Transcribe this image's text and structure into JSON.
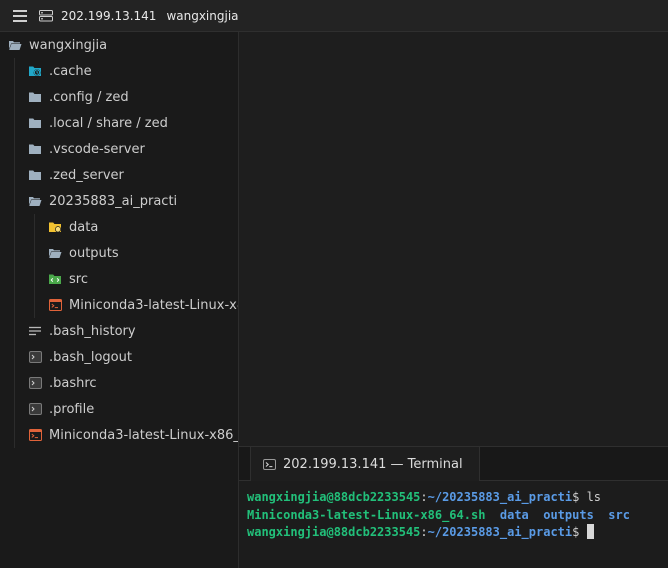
{
  "titlebar": {
    "menu_icon": "hamburger-menu-icon",
    "server_icon": "remote-server-icon",
    "host": "202.199.13.141",
    "project": "wangxingjia"
  },
  "sidebar": {
    "root": {
      "label": "wangxingjia",
      "icon": "folder-open-icon"
    },
    "items": [
      {
        "label": ".cache",
        "icon": "cache-folder-icon"
      },
      {
        "label": ".config / zed",
        "icon": "folder-icon"
      },
      {
        "label": ".local / share / zed",
        "icon": "folder-icon"
      },
      {
        "label": ".vscode-server",
        "icon": "folder-icon"
      },
      {
        "label": ".zed_server",
        "icon": "folder-icon"
      },
      {
        "label": "20235883_ai_practi",
        "icon": "folder-open-icon"
      },
      {
        "label": "data",
        "icon": "data-folder-icon"
      },
      {
        "label": "outputs",
        "icon": "folder-open-icon"
      },
      {
        "label": "src",
        "icon": "source-folder-icon"
      },
      {
        "label": "Miniconda3-latest-Linux-x8",
        "icon": "shell-script-icon"
      },
      {
        "label": ".bash_history",
        "icon": "text-lines-icon"
      },
      {
        "label": ".bash_logout",
        "icon": "terminal-file-icon"
      },
      {
        "label": ".bashrc",
        "icon": "terminal-file-icon"
      },
      {
        "label": ".profile",
        "icon": "terminal-file-icon"
      },
      {
        "label": "Miniconda3-latest-Linux-x86_",
        "icon": "shell-script-icon"
      }
    ]
  },
  "terminal": {
    "tab_label": "202.199.13.141 — Terminal",
    "tab_icon": "terminal-icon",
    "lines": [
      {
        "user": "wangxingjia@88dcb2233545",
        "sep": ":",
        "path": "~/20235883_ai_practi",
        "prompt": "$ ",
        "cmd": "ls"
      },
      {
        "output": "Miniconda3-latest-Linux-x86_64.sh",
        "dirs": [
          "data",
          "outputs",
          "src"
        ]
      },
      {
        "user": "wangxingjia@88dcb2233545",
        "sep": ":",
        "path": "~/20235883_ai_practi",
        "prompt": "$ ",
        "cmd": ""
      }
    ]
  },
  "colors": {
    "prompt_green": "#22c07a",
    "path_blue": "#5a9be6",
    "folder_gray": "#9fb0bf",
    "cache_teal": "#21a8c9",
    "data_yellow": "#f2c231",
    "src_green": "#4aa84a",
    "script_orange": "#e0633a"
  }
}
